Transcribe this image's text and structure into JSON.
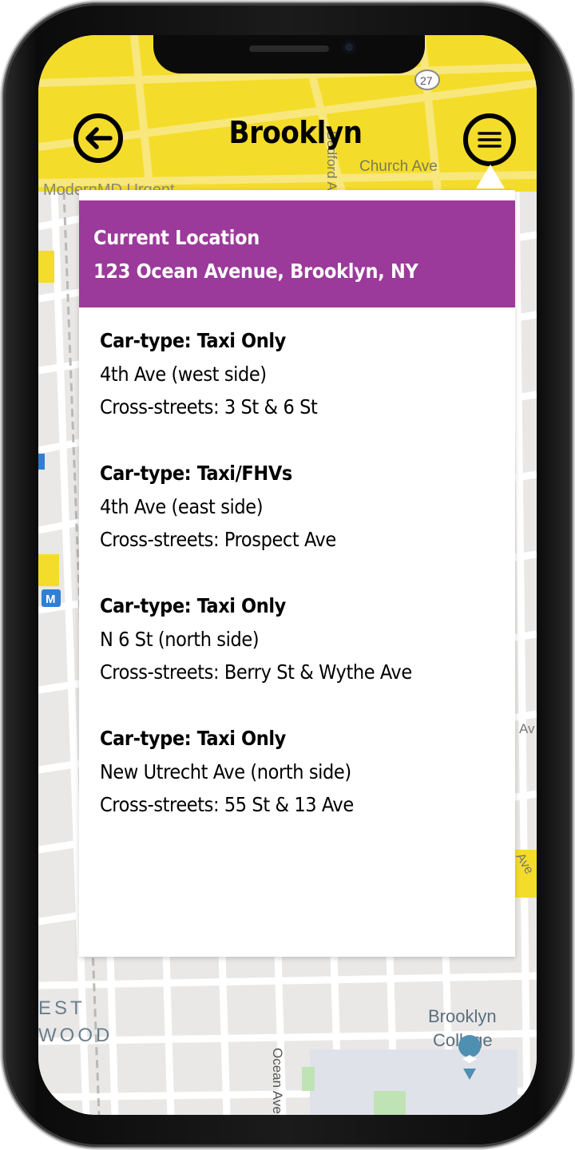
{
  "header": {
    "title": "Brooklyn"
  },
  "location": {
    "heading": "Current Location",
    "address": "123 Ocean Avenue, Brooklyn, NY"
  },
  "stands": [
    {
      "car_type": "Car-type: Taxi Only",
      "street": "4th Ave (west side)",
      "cross": "Cross-streets: 3 St & 6 St"
    },
    {
      "car_type": "Car-type: Taxi/FHVs",
      "street": "4th Ave (east side)",
      "cross": "Cross-streets: Prospect Ave"
    },
    {
      "car_type": "Car-type: Taxi Only",
      "street": "N 6 St (north side)",
      "cross": "Cross-streets: Berry St & Wythe Ave"
    },
    {
      "car_type": "Car-type: Taxi Only",
      "street": "New Utrecht Ave (north side)",
      "cross": "Cross-streets: 55 St & 13 Ave"
    }
  ],
  "map": {
    "labels": {
      "route": "27",
      "church_ave": "Church Ave",
      "modernmd": "ModernMD Urgent",
      "bedford": "Bedford Av",
      "college_line1": "Brooklyn",
      "college_line2": "College",
      "ocean_ave": "Ocean Ave",
      "kensington_line1": "EST",
      "kensington_line2": "WOOD",
      "right_av": "Av",
      "right_ave": "Ave",
      "subway1": "M",
      "subway2": "M"
    }
  },
  "icons": {
    "back": "arrow-left-circle-icon",
    "menu": "hamburger-menu-icon",
    "college": "graduation-cap-pin-icon"
  },
  "colors": {
    "header_yellow": "#f4dc2a",
    "panel_purple": "#9b3a9a",
    "map_bg": "#e9e8e6"
  }
}
